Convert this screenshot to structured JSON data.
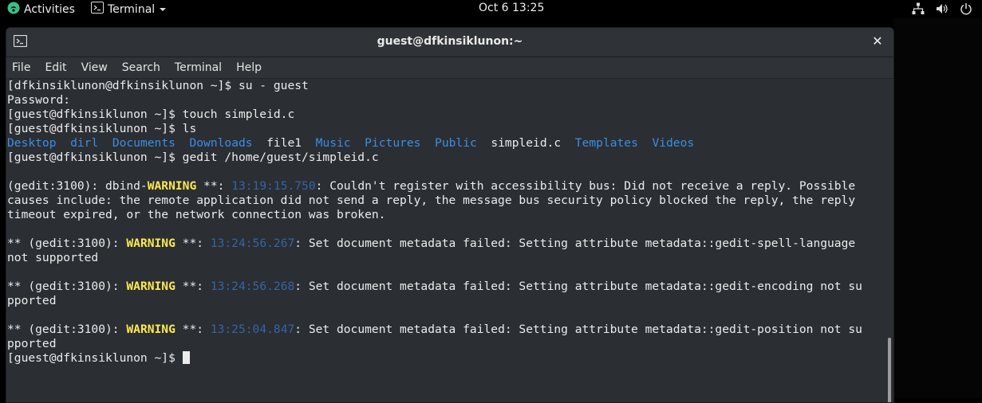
{
  "topbar": {
    "activities": "Activities",
    "app_menu": "Terminal",
    "clock": "Oct 6  13:25"
  },
  "window": {
    "title": "guest@dfkinsiklunon:~",
    "close_glyph": "✕"
  },
  "menu": {
    "file": "File",
    "edit": "Edit",
    "view": "View",
    "search": "Search",
    "terminal": "Terminal",
    "help": "Help"
  },
  "terminal": {
    "l1": "[dfkinsiklunon@dfkinsiklunon ~]$ su - guest",
    "l2": "Password:",
    "l3": "[guest@dfkinsiklunon ~]$ touch simpleid.c",
    "l4": "[guest@dfkinsiklunon ~]$ ls",
    "ls": {
      "desktop": "Desktop",
      "dirl": "dirl",
      "documents": "Documents",
      "downloads": "Downloads",
      "file1": "file1",
      "music": "Music",
      "pictures": "Pictures",
      "public": "Public",
      "simpleid": "simpleid.c",
      "templates": "Templates",
      "videos": "Videos"
    },
    "l6": "[guest@dfkinsiklunon ~]$ gedit /home/guest/simpleid.c",
    "w1": {
      "prefix": "(gedit:3100): dbind-",
      "warn": "WARNING",
      "stars": " **: ",
      "time": "13:19:15.750",
      "msg1": ": Couldn't register with accessibility bus: Did not receive a reply. Possible",
      "msg2": "causes include: the remote application did not send a reply, the message bus security policy blocked the reply, the reply",
      "msg3": "timeout expired, or the network connection was broken."
    },
    "w2": {
      "prefix": "** (gedit:3100): ",
      "warn": "WARNING",
      "stars": " **: ",
      "time": "13:24:56.267",
      "msg1": ": Set document metadata failed: Setting attribute metadata::gedit-spell-language",
      "msg2": "not supported"
    },
    "w3": {
      "prefix": "** (gedit:3100): ",
      "warn": "WARNING",
      "stars": " **: ",
      "time": "13:24:56.268",
      "msg1": ": Set document metadata failed: Setting attribute metadata::gedit-encoding not su",
      "msg2": "pported"
    },
    "w4": {
      "prefix": "** (gedit:3100): ",
      "warn": "WARNING",
      "stars": " **: ",
      "time": "13:25:04.847",
      "msg1": ": Set document metadata failed: Setting attribute metadata::gedit-position not su",
      "msg2": "pported"
    },
    "prompt": "[guest@dfkinsiklunon ~]$ "
  },
  "icons": {
    "activities": "gnome-activities-icon",
    "terminal_app": "terminal-icon",
    "app_menu_arrow": "chevron-down-icon",
    "network": "network-icon",
    "volume": "volume-icon",
    "power": "power-icon",
    "window_icon": "terminal-window-icon",
    "close": "close-icon"
  },
  "colors": {
    "terminal_bg": "#2b2e33",
    "dir_blue": "#3a8ee6",
    "timestamp_blue": "#3465a4",
    "warning_yellow": "#fce94f"
  }
}
